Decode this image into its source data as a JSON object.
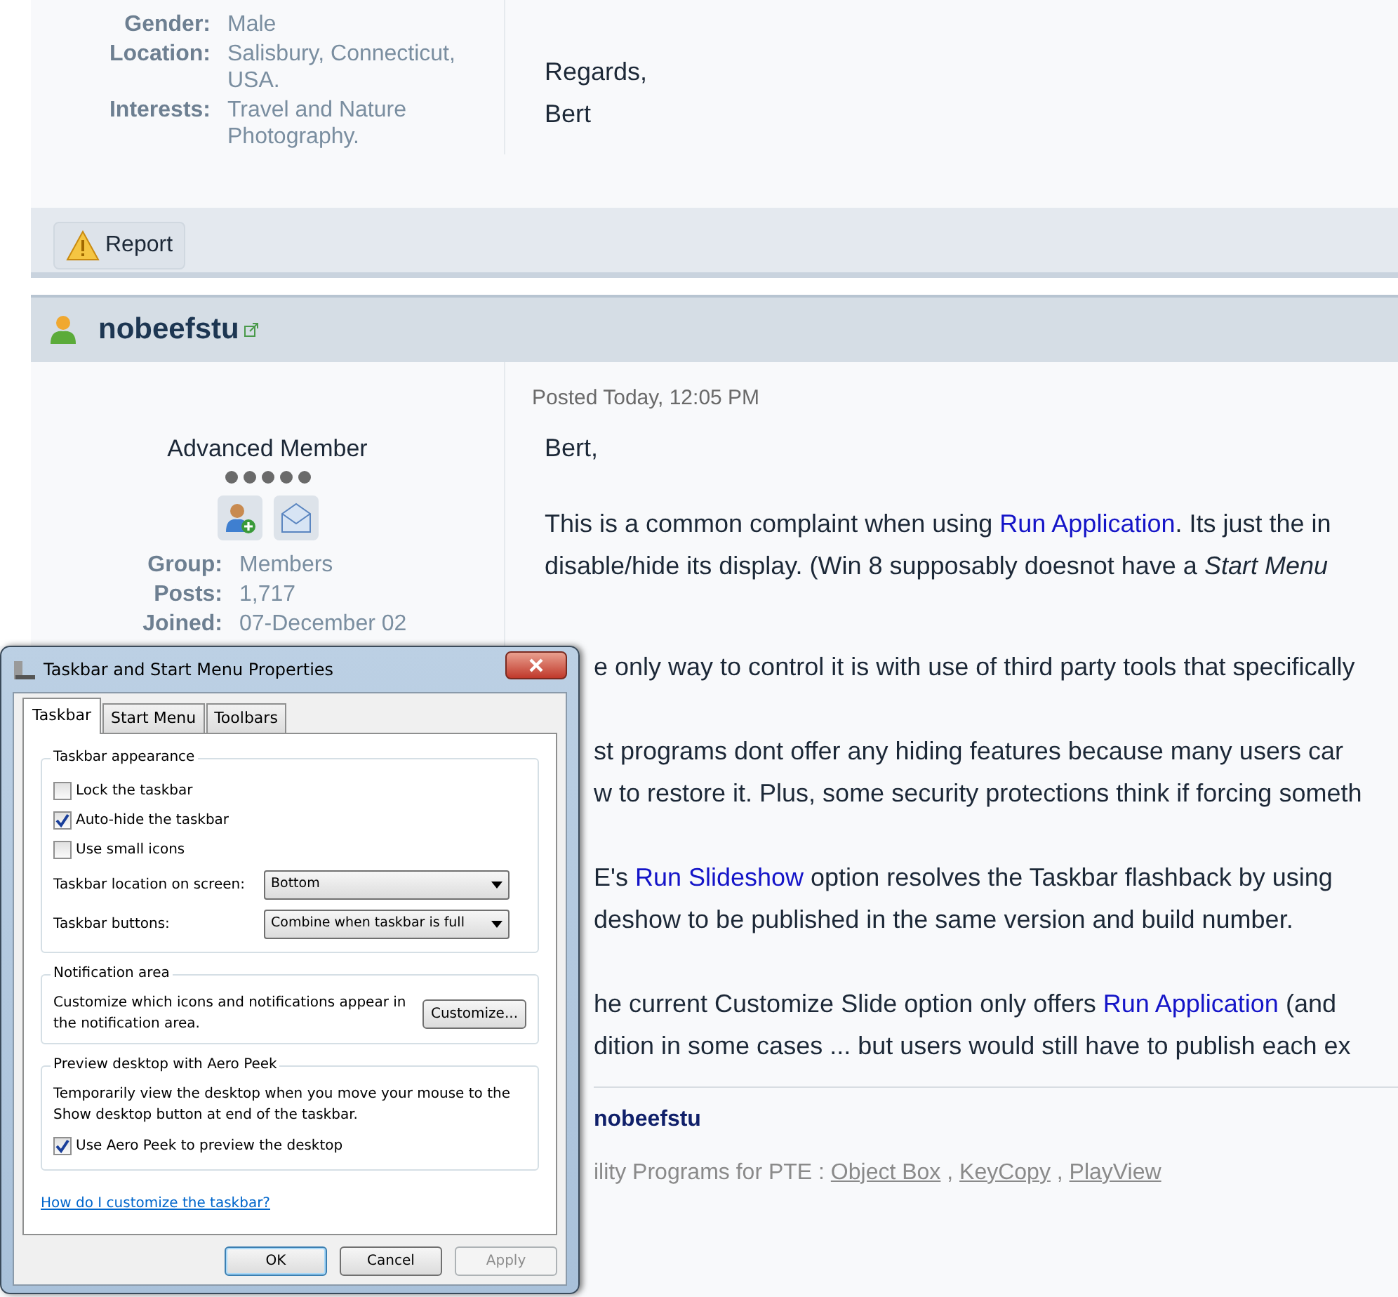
{
  "prev_post": {
    "profile": [
      {
        "label": "Gender:",
        "value": "Male"
      },
      {
        "label": "Location:",
        "value": "Salisbury, Connecticut, USA."
      },
      {
        "label": "Interests:",
        "value": "Travel and Nature Photography."
      }
    ],
    "closing": [
      "Regards,",
      "Bert"
    ]
  },
  "report_button": "Report",
  "post": {
    "author": "nobeefstu",
    "rank": "Advanced Member",
    "profile": [
      {
        "label": "Group:",
        "value": "Members"
      },
      {
        "label": "Posts:",
        "value": "1,717"
      },
      {
        "label": "Joined:",
        "value": "07-December 02"
      }
    ],
    "posted": "Posted Today, 12:05 PM",
    "greeting": "Bert,",
    "paragraphs": [
      [
        [
          {
            "text": "This is a common complaint when using ",
            "kind": "text"
          },
          {
            "text": "Run Application",
            "kind": "link"
          },
          {
            "text": ". Its just the in",
            "kind": "text"
          }
        ],
        [
          {
            "text": "disable/hide its display. (Win 8 supposably doesnot have a *Start Menu*",
            "kind": "text"
          }
        ]
      ]
    ],
    "continued": [
      [
        [
          {
            "text": "e only way to control it is with use of third party tools that specifically",
            "kind": "text"
          }
        ]
      ],
      [
        [
          {
            "text": "st programs dont offer any hiding features because many users car",
            "kind": "text"
          }
        ],
        [
          {
            "text": "w to restore it. Plus, some security protections think if forcing someth",
            "kind": "text"
          }
        ]
      ],
      [
        [
          {
            "text": "E's ",
            "kind": "text"
          },
          {
            "text": "Run Slideshow",
            "kind": "link"
          },
          {
            "text": " option resolves the Taskbar flashback by using",
            "kind": "text"
          }
        ],
        [
          {
            "text": "deshow to be published in the same version and build number.",
            "kind": "text"
          }
        ]
      ],
      [
        [
          {
            "text": "he current Customize Slide option only offers ",
            "kind": "text"
          },
          {
            "text": "Run Application",
            "kind": "link"
          },
          {
            "text": " (and",
            "kind": "text"
          }
        ],
        [
          {
            "text": "dition in some cases ... but users would still have to publish each ex",
            "kind": "text"
          }
        ]
      ]
    ],
    "signature_name": "nobeefstu",
    "signature_line": [
      {
        "text": "ility Programs for PTE : ",
        "kind": "text"
      },
      {
        "text": "Object Box",
        "kind": "link"
      },
      {
        "text": " , ",
        "kind": "text"
      },
      {
        "text": "KeyCopy",
        "kind": "link"
      },
      {
        "text": " , ",
        "kind": "text"
      },
      {
        "text": "PlayView",
        "kind": "link"
      }
    ]
  },
  "dialog": {
    "title": "Taskbar and Start Menu Properties",
    "tabs": [
      {
        "label": "Taskbar",
        "selected": true
      },
      {
        "label": "Start Menu",
        "selected": false
      },
      {
        "label": "Toolbars",
        "selected": false
      }
    ],
    "groups": [
      {
        "legend": "Taskbar appearance",
        "items": [
          {
            "kind": "checkbox",
            "label": "Lock the taskbar",
            "checked": false
          },
          {
            "kind": "checkbox",
            "label": "Auto-hide the taskbar",
            "checked": true
          },
          {
            "kind": "checkbox",
            "label": "Use small icons",
            "checked": false
          },
          {
            "kind": "select",
            "label": "Taskbar location on screen:",
            "value": "Bottom"
          },
          {
            "kind": "select",
            "label": "Taskbar buttons:",
            "value": "Combine when taskbar is full"
          }
        ]
      },
      {
        "legend": "Notification area",
        "items": [
          {
            "kind": "text_button",
            "text": "Customize which icons and notifications appear in the notification area.",
            "button": "Customize..."
          }
        ]
      },
      {
        "legend": "Preview desktop with Aero Peek",
        "items": [
          {
            "kind": "text",
            "text": "Temporarily view the desktop when you move your mouse to the Show desktop button at end of the taskbar."
          },
          {
            "kind": "checkbox",
            "label": "Use Aero Peek to preview the desktop",
            "checked": true
          }
        ]
      }
    ],
    "help_link": "How do I customize the taskbar?",
    "buttons": [
      {
        "label": "OK",
        "default": true,
        "disabled": false
      },
      {
        "label": "Cancel",
        "default": false,
        "disabled": false
      },
      {
        "label": "Apply",
        "default": false,
        "disabled": true
      }
    ]
  }
}
